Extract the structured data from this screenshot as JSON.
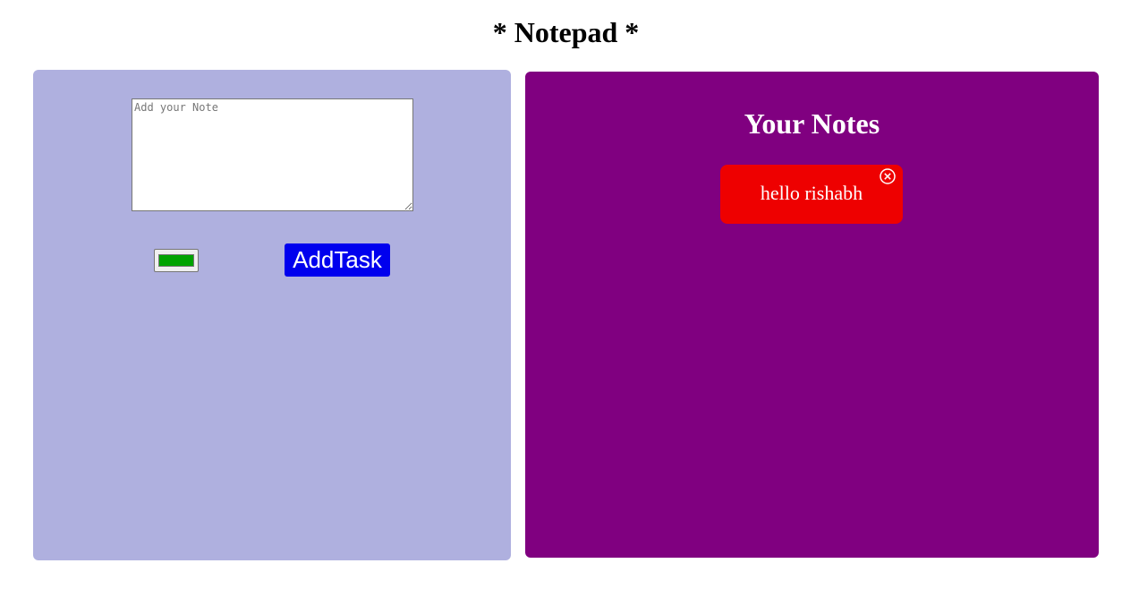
{
  "page": {
    "title": "* Notepad *"
  },
  "composer": {
    "note_placeholder": "Add your Note",
    "note_value": "",
    "color_value": "#00a300",
    "add_button_label": "AddTask"
  },
  "notes_panel": {
    "heading": "Your Notes",
    "notes": [
      {
        "text": "hello rishabh",
        "color": "#ee0000",
        "close_icon": "circle-x-icon"
      }
    ]
  },
  "colors": {
    "left_panel_bg": "#afb0df",
    "right_panel_bg": "#800080",
    "add_button_bg": "#0000ee",
    "note_card_bg": "#ee0000"
  }
}
